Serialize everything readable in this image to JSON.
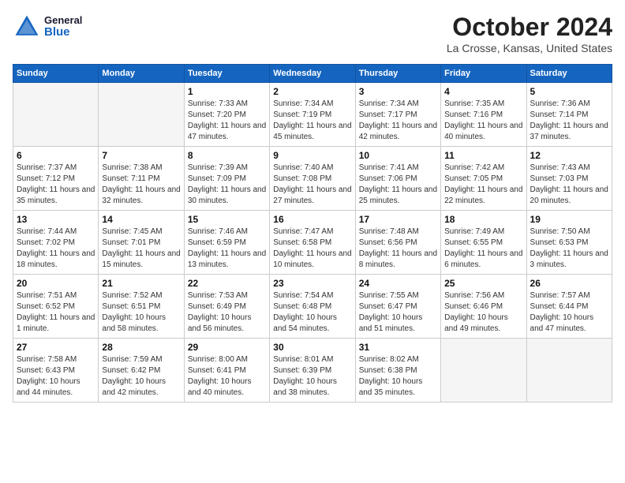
{
  "logo": {
    "general": "General",
    "blue": "Blue"
  },
  "header": {
    "title": "October 2024",
    "location": "La Crosse, Kansas, United States"
  },
  "days_of_week": [
    "Sunday",
    "Monday",
    "Tuesday",
    "Wednesday",
    "Thursday",
    "Friday",
    "Saturday"
  ],
  "weeks": [
    [
      {
        "day": "",
        "info": ""
      },
      {
        "day": "",
        "info": ""
      },
      {
        "day": "1",
        "info": "Sunrise: 7:33 AM\nSunset: 7:20 PM\nDaylight: 11 hours and 47 minutes."
      },
      {
        "day": "2",
        "info": "Sunrise: 7:34 AM\nSunset: 7:19 PM\nDaylight: 11 hours and 45 minutes."
      },
      {
        "day": "3",
        "info": "Sunrise: 7:34 AM\nSunset: 7:17 PM\nDaylight: 11 hours and 42 minutes."
      },
      {
        "day": "4",
        "info": "Sunrise: 7:35 AM\nSunset: 7:16 PM\nDaylight: 11 hours and 40 minutes."
      },
      {
        "day": "5",
        "info": "Sunrise: 7:36 AM\nSunset: 7:14 PM\nDaylight: 11 hours and 37 minutes."
      }
    ],
    [
      {
        "day": "6",
        "info": "Sunrise: 7:37 AM\nSunset: 7:12 PM\nDaylight: 11 hours and 35 minutes."
      },
      {
        "day": "7",
        "info": "Sunrise: 7:38 AM\nSunset: 7:11 PM\nDaylight: 11 hours and 32 minutes."
      },
      {
        "day": "8",
        "info": "Sunrise: 7:39 AM\nSunset: 7:09 PM\nDaylight: 11 hours and 30 minutes."
      },
      {
        "day": "9",
        "info": "Sunrise: 7:40 AM\nSunset: 7:08 PM\nDaylight: 11 hours and 27 minutes."
      },
      {
        "day": "10",
        "info": "Sunrise: 7:41 AM\nSunset: 7:06 PM\nDaylight: 11 hours and 25 minutes."
      },
      {
        "day": "11",
        "info": "Sunrise: 7:42 AM\nSunset: 7:05 PM\nDaylight: 11 hours and 22 minutes."
      },
      {
        "day": "12",
        "info": "Sunrise: 7:43 AM\nSunset: 7:03 PM\nDaylight: 11 hours and 20 minutes."
      }
    ],
    [
      {
        "day": "13",
        "info": "Sunrise: 7:44 AM\nSunset: 7:02 PM\nDaylight: 11 hours and 18 minutes."
      },
      {
        "day": "14",
        "info": "Sunrise: 7:45 AM\nSunset: 7:01 PM\nDaylight: 11 hours and 15 minutes."
      },
      {
        "day": "15",
        "info": "Sunrise: 7:46 AM\nSunset: 6:59 PM\nDaylight: 11 hours and 13 minutes."
      },
      {
        "day": "16",
        "info": "Sunrise: 7:47 AM\nSunset: 6:58 PM\nDaylight: 11 hours and 10 minutes."
      },
      {
        "day": "17",
        "info": "Sunrise: 7:48 AM\nSunset: 6:56 PM\nDaylight: 11 hours and 8 minutes."
      },
      {
        "day": "18",
        "info": "Sunrise: 7:49 AM\nSunset: 6:55 PM\nDaylight: 11 hours and 6 minutes."
      },
      {
        "day": "19",
        "info": "Sunrise: 7:50 AM\nSunset: 6:53 PM\nDaylight: 11 hours and 3 minutes."
      }
    ],
    [
      {
        "day": "20",
        "info": "Sunrise: 7:51 AM\nSunset: 6:52 PM\nDaylight: 11 hours and 1 minute."
      },
      {
        "day": "21",
        "info": "Sunrise: 7:52 AM\nSunset: 6:51 PM\nDaylight: 10 hours and 58 minutes."
      },
      {
        "day": "22",
        "info": "Sunrise: 7:53 AM\nSunset: 6:49 PM\nDaylight: 10 hours and 56 minutes."
      },
      {
        "day": "23",
        "info": "Sunrise: 7:54 AM\nSunset: 6:48 PM\nDaylight: 10 hours and 54 minutes."
      },
      {
        "day": "24",
        "info": "Sunrise: 7:55 AM\nSunset: 6:47 PM\nDaylight: 10 hours and 51 minutes."
      },
      {
        "day": "25",
        "info": "Sunrise: 7:56 AM\nSunset: 6:46 PM\nDaylight: 10 hours and 49 minutes."
      },
      {
        "day": "26",
        "info": "Sunrise: 7:57 AM\nSunset: 6:44 PM\nDaylight: 10 hours and 47 minutes."
      }
    ],
    [
      {
        "day": "27",
        "info": "Sunrise: 7:58 AM\nSunset: 6:43 PM\nDaylight: 10 hours and 44 minutes."
      },
      {
        "day": "28",
        "info": "Sunrise: 7:59 AM\nSunset: 6:42 PM\nDaylight: 10 hours and 42 minutes."
      },
      {
        "day": "29",
        "info": "Sunrise: 8:00 AM\nSunset: 6:41 PM\nDaylight: 10 hours and 40 minutes."
      },
      {
        "day": "30",
        "info": "Sunrise: 8:01 AM\nSunset: 6:39 PM\nDaylight: 10 hours and 38 minutes."
      },
      {
        "day": "31",
        "info": "Sunrise: 8:02 AM\nSunset: 6:38 PM\nDaylight: 10 hours and 35 minutes."
      },
      {
        "day": "",
        "info": ""
      },
      {
        "day": "",
        "info": ""
      }
    ]
  ]
}
